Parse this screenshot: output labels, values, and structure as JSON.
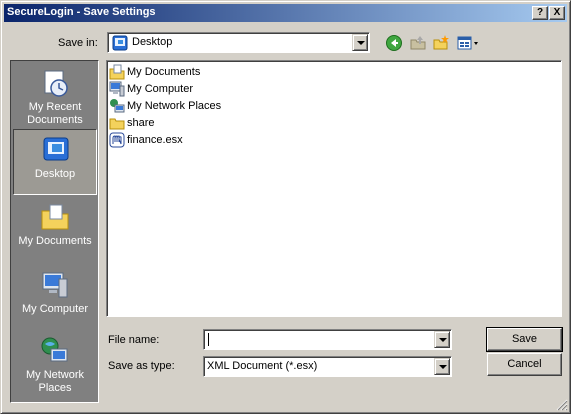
{
  "window": {
    "title": "SecureLogin - Save Settings",
    "help_glyph": "?",
    "close_glyph": "X"
  },
  "save_in": {
    "label": "Save in:",
    "value": "Desktop",
    "icon": "desktop-icon"
  },
  "toolbar": {
    "icons": [
      "back-icon",
      "up-folder-icon",
      "new-folder-icon",
      "views-menu-icon"
    ]
  },
  "places_bar": {
    "items": [
      {
        "label": "My Recent Documents",
        "icon": "recent-documents-icon",
        "selected": false
      },
      {
        "label": "Desktop",
        "icon": "desktop-icon",
        "selected": true
      },
      {
        "label": "My Documents",
        "icon": "my-documents-folder-icon",
        "selected": false
      },
      {
        "label": "My Computer",
        "icon": "my-computer-icon",
        "selected": false
      },
      {
        "label": "My Network Places",
        "icon": "network-places-icon",
        "selected": false
      }
    ]
  },
  "file_list": {
    "items": [
      {
        "label": "My Documents",
        "icon": "my-documents-icon"
      },
      {
        "label": "My Computer",
        "icon": "my-computer-icon"
      },
      {
        "label": "My Network Places",
        "icon": "network-places-icon"
      },
      {
        "label": "share",
        "icon": "folder-icon"
      },
      {
        "label": "finance.esx",
        "icon": "esx-file-icon"
      }
    ]
  },
  "file_name": {
    "label": "File name:",
    "value": ""
  },
  "save_as_type": {
    "label": "Save as type:",
    "value": "XML Document (*.esx)"
  },
  "buttons": {
    "save": "Save",
    "cancel": "Cancel"
  },
  "colors": {
    "title_start": "#0a246a",
    "title_end": "#a6caf0",
    "face": "#d4d0c8",
    "places_bg": "#808080"
  }
}
